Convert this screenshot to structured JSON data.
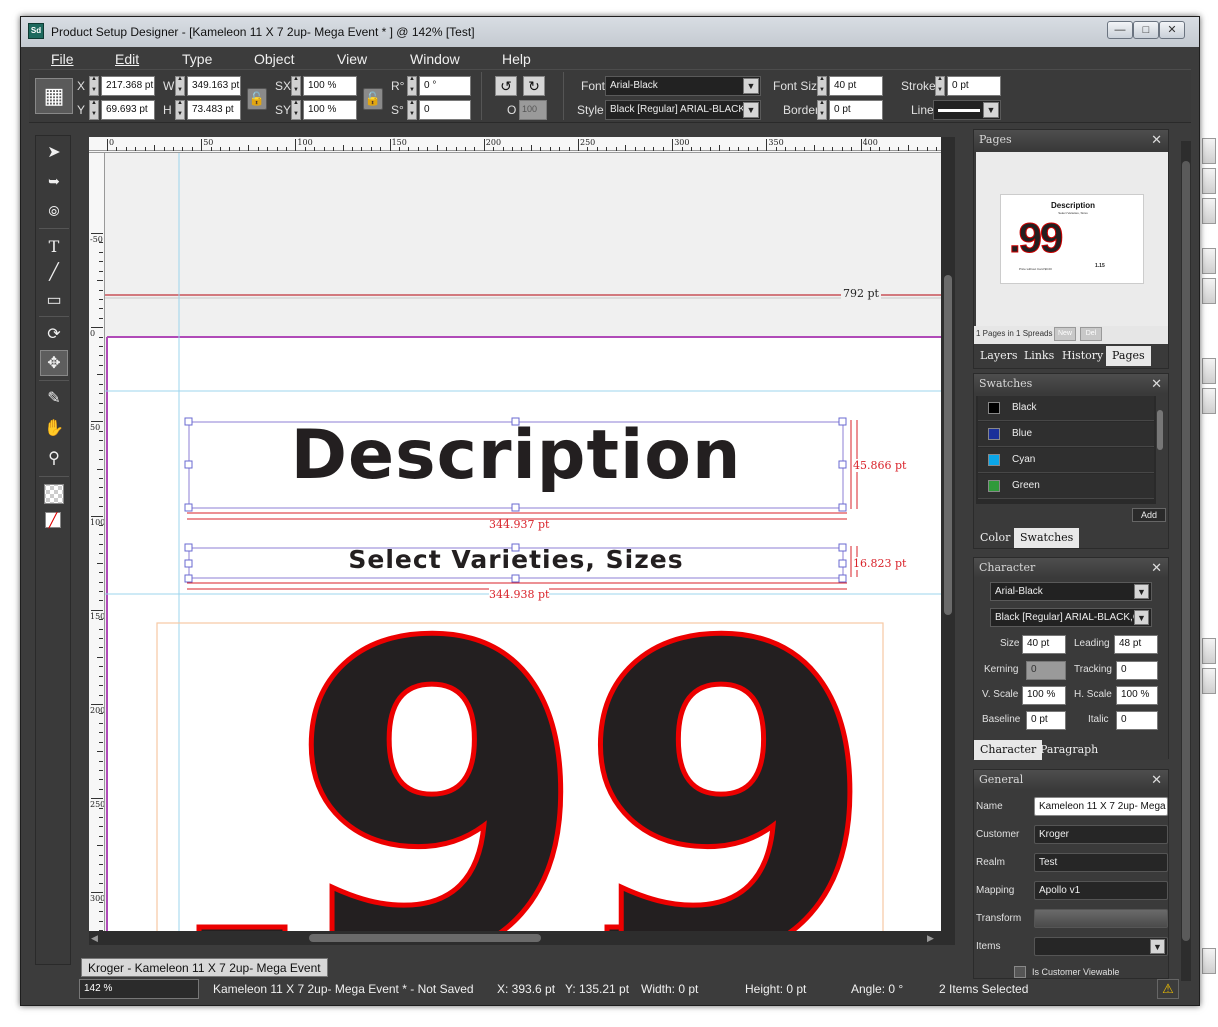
{
  "window": {
    "title": "Product Setup Designer - [Kameleon 11 X 7 2up- Mega Event * ] @ 142% [Test]",
    "app_icon": "Sd"
  },
  "menu": [
    "File",
    "Edit",
    "Type",
    "Object",
    "View",
    "Window",
    "Help"
  ],
  "toolbar": {
    "x_label": "X",
    "x_value": "217.368 pt",
    "y_label": "Y",
    "y_value": "69.693 pt",
    "w_label": "W",
    "w_value": "349.163 pt",
    "h_label": "H",
    "h_value": "73.483 pt",
    "sx_label": "SX",
    "sx_value": "100 %",
    "sy_label": "SY",
    "sy_value": "100 %",
    "r_label": "R°",
    "r_value": "0 °",
    "s_label": "S°",
    "s_value": "0",
    "o_label": "O",
    "o_value": "100",
    "font_label": "Font",
    "font_value": "Arial-Black",
    "style_label": "Style",
    "style_value": "Black [Regular] ARIAL-BLACK",
    "fontsize_label": "Font Size",
    "fontsize_value": "40 pt",
    "border_label": "Border",
    "border_value": "0 pt",
    "stroke_label": "Stroke",
    "stroke_value": "0 pt",
    "line_label": "Line"
  },
  "canvas": {
    "ruler_top": [
      "0",
      "50",
      "100",
      "150",
      "200",
      "250",
      "300",
      "350",
      "400"
    ],
    "ruler_left": [
      "-50",
      "0",
      "50",
      "100",
      "150",
      "200",
      "250",
      "300"
    ],
    "dim_792": "792 pt",
    "description_text": "Description",
    "subtitle_text": "Select Varieties, Sizes",
    "dim_width_1": "344.937 pt",
    "dim_height_1": "45.866 pt",
    "dim_width_2": "344.938 pt",
    "dim_height_2": "16.823 pt",
    "price_text": "99",
    "colors": {
      "price_fill": "#231f20",
      "price_stroke": "#ec0000",
      "dim": "#d9222a"
    }
  },
  "doc_tab": "Kroger - Kameleon 11 X 7 2up- Mega Event",
  "status": {
    "zoom": "142 %",
    "doc": "Kameleon 11 X 7 2up- Mega Event  * - Not Saved",
    "x": "X: 393.6 pt",
    "y": "Y: 135.21 pt",
    "width": "Width: 0 pt",
    "height": "Height: 0 pt",
    "angle": "Angle: 0 °",
    "selected": "2 Items Selected"
  },
  "pages_panel": {
    "title": "Pages",
    "thumb_title": "Description",
    "thumb_sub": "Select Varieties, Sizes",
    "thumb_price": ".99",
    "thumb_note": "Price without Card $0.00",
    "thumb_side": "1.15",
    "spreads": "1 Pages in 1 Spreads",
    "new_btn": "New",
    "del_btn": "Del",
    "tabs": [
      "Layers",
      "Links",
      "History",
      "Pages"
    ]
  },
  "swatches_panel": {
    "title": "Swatches",
    "items": [
      {
        "name": "Black",
        "color": "#000000"
      },
      {
        "name": "Blue",
        "color": "#1a2f9a"
      },
      {
        "name": "Cyan",
        "color": "#0aa6e8"
      },
      {
        "name": "Green",
        "color": "#2f9a3a"
      }
    ],
    "add_btn": "Add",
    "tabs": [
      "Color",
      "Swatches"
    ]
  },
  "character_panel": {
    "title": "Character",
    "font": "Arial-Black",
    "style": "Black [Regular] ARIAL-BLACK,C",
    "size_label": "Size",
    "size": "40 pt",
    "leading_label": "Leading",
    "leading": "48 pt",
    "kerning_label": "Kerning",
    "kerning": "0",
    "tracking_label": "Tracking",
    "tracking": "0",
    "vscale_label": "V. Scale",
    "vscale": "100 %",
    "hscale_label": "H. Scale",
    "hscale": "100 %",
    "baseline_label": "Baseline",
    "baseline": "0 pt",
    "italic_label": "Italic",
    "italic": "0",
    "tabs": [
      "Character",
      "Paragraph"
    ]
  },
  "general_panel": {
    "title": "General",
    "name_label": "Name",
    "name": "Kameleon 11 X 7 2up- Mega",
    "customer_label": "Customer",
    "customer": "Kroger",
    "realm_label": "Realm",
    "realm": "Test",
    "mapping_label": "Mapping",
    "mapping": "Apollo v1",
    "transform_label": "Transform",
    "items_label": "Items",
    "viewable_label": "Is Customer Viewable"
  }
}
